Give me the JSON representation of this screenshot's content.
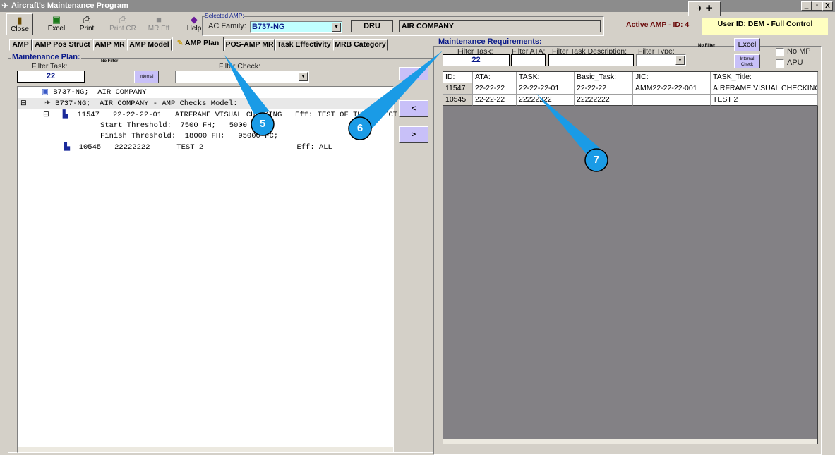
{
  "window": {
    "title": "Aircraft's Maintenance Program",
    "minimize": "_",
    "restore": "▫",
    "close": "X"
  },
  "toolbar": [
    {
      "label": "Close",
      "icon": "door-exit-icon",
      "enabled": true
    },
    {
      "label": "Excel",
      "icon": "excel-icon",
      "enabled": true
    },
    {
      "label": "Print",
      "icon": "printer-icon",
      "enabled": true
    },
    {
      "label": "Print CR",
      "icon": "printer-icon",
      "enabled": false
    },
    {
      "label": "MR Eff",
      "icon": "square-icon",
      "enabled": false
    },
    {
      "label": "Help",
      "icon": "help-book-icon",
      "enabled": true
    }
  ],
  "selected_amp": {
    "group_label": "Selected AMP:",
    "ac_family_label": "AC Family:",
    "ac_family_value": "B737-NG",
    "code": "DRU",
    "company": "AIR COMPANY"
  },
  "status": {
    "active_amp": "Active AMP - ID: 4",
    "user": "User ID: DEM - Full Control"
  },
  "tabs": [
    "AMP",
    "AMP Pos Struct",
    "AMP MR",
    "AMP Model",
    "AMP Plan",
    "POS-AMP MR",
    "Task Effectivity",
    "MRB Category"
  ],
  "active_tab": "AMP Plan",
  "plan": {
    "title": "Maintenance Plan:",
    "filter_task_label": "Filter Task:",
    "filter_task_value": "22",
    "no_filter": "No Filter",
    "internal_button": "Internal",
    "filter_check_label": "Filter Check:",
    "filter_check_value": "",
    "tree": [
      "B737-NG;  AIR COMPANY",
      "B737-NG;  AIR COMPANY - AMP Checks Model:",
      "11547   22-22-22-01   AIRFRAME VISUAL CHECKING   Eff: TEST OF THE EFFECT",
      "Start Threshold:  7500 FH;   5000 FC;",
      "Finish Threshold:  18000 FH;   95000 FC;",
      "10545   22222222      TEST 2                     Eff: ALL"
    ]
  },
  "move_buttons": {
    "add": "<",
    "remove": ">"
  },
  "requirements": {
    "title": "Maintenance Requirements:",
    "filter_task_label": "Filter Task:",
    "filter_task_value": "22",
    "filter_ata_label": "Filter ATA:",
    "filter_ata_value": "",
    "filter_desc_label": "Filter Task Description:",
    "filter_desc_value": "",
    "filter_type_label": "Filter Type:",
    "filter_type_value": "",
    "no_filter": "No Filter",
    "excel_button": "Excel",
    "internal_check_button": "Internal Check",
    "no_mp_label": "No MP",
    "no_mp_checked": false,
    "apu_label": "APU",
    "apu_checked": false,
    "columns": [
      "ID:",
      "ATA:",
      "TASK:",
      "Basic_Task:",
      "JIC:",
      "TASK_Title:"
    ],
    "rows": [
      [
        "11547",
        "22-22-22",
        "22-22-22-01",
        "22-22-22",
        "AMM22-22-22-001",
        "AIRFRAME VISUAL CHECKING"
      ],
      [
        "10545",
        "22-22-22",
        "22222222",
        "22222222",
        "",
        "TEST 2"
      ]
    ]
  },
  "callouts": [
    "5",
    "6",
    "7"
  ],
  "colors": {
    "callout": "#1a9be6",
    "grid_bg": "#838185",
    "user_bg": "#ffffc0",
    "combo_bg": "#c0ffff",
    "button_blue": "#c8c0f8"
  }
}
